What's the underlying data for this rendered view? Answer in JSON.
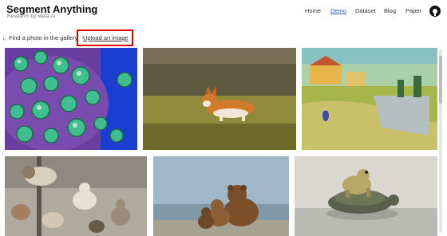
{
  "header": {
    "title": "Segment Anything",
    "subtitle": "Research by Meta AI",
    "nav": [
      {
        "label": "Home",
        "active": false
      },
      {
        "label": "Demo",
        "active": true
      },
      {
        "label": "Dataset",
        "active": false
      },
      {
        "label": "Blog",
        "active": false
      },
      {
        "label": "Paper",
        "active": false
      }
    ],
    "github_icon": "github-icon"
  },
  "gallery": {
    "prompt": "Find a photo in the gallery,",
    "upload_label": "Upload an image",
    "images": [
      {
        "subject": "virus-microscopy"
      },
      {
        "subject": "corgi-running"
      },
      {
        "subject": "landscape-painting"
      },
      {
        "subject": "cats-jumping"
      },
      {
        "subject": "bears-on-shore"
      },
      {
        "subject": "frog-on-turtle"
      }
    ]
  },
  "colors": {
    "accent": "#3a5fc4",
    "highlight": "#e00000"
  }
}
